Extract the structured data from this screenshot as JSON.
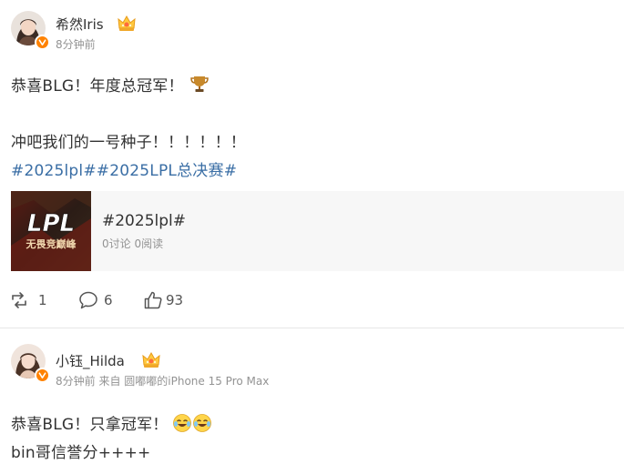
{
  "post1": {
    "username": "希然Iris",
    "time": "8分钟前",
    "content_line1": "恭喜BLG！年度总冠军！",
    "content_line2": "冲吧我们的一号种子！！！！！！",
    "hashtag1": "#2025lpl#",
    "hashtag2": "#2025LPL总决赛#",
    "topic_card": {
      "title": "#2025lpl#",
      "stats": "0讨论 0阅读",
      "thumb_text": "LPL",
      "thumb_subtext": "无畏竞巅峰"
    },
    "actions": {
      "repost_count": "1",
      "comment_count": "6",
      "like_count": "93"
    }
  },
  "post2": {
    "username": "小钰_Hilda",
    "meta": "8分钟前  来自 圆嘟嘟的iPhone 15 Pro Max",
    "content_line1": "恭喜BLG！只拿冠军！",
    "content_line2": "bin哥信誉分++++"
  },
  "colors": {
    "hashtag": "#3a6ea5",
    "meta": "#939393",
    "verified_badge": "#ff8200"
  }
}
